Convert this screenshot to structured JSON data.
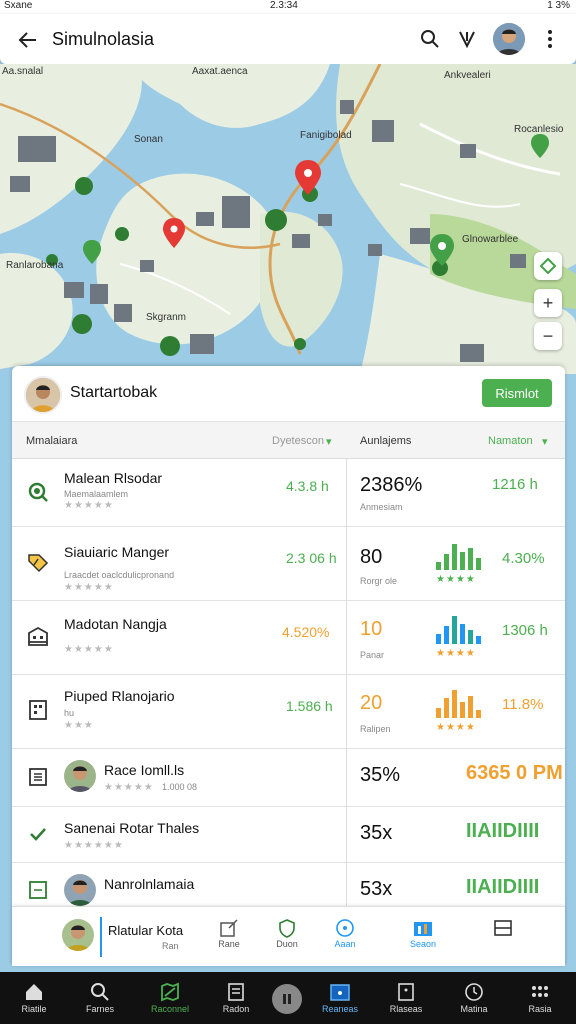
{
  "status_bar": {
    "left": "Sxane",
    "time": "2.3:34",
    "right": "1 3%"
  },
  "app_bar": {
    "title": "Simulnolasia"
  },
  "map": {
    "labels": [
      "Aa.snalal",
      "Aaxat.aenca",
      "Ankvealeri",
      "Sonan",
      "Fanigibolad",
      "Rocanlesio",
      "Ranlarobana",
      "Skgranm",
      "Glnowarblee"
    ]
  },
  "panel": {
    "title": "Startartobak",
    "action_button": "Rismlot",
    "columns": {
      "c1": "Mmalaiara",
      "c2": "Dyetescon",
      "c3": "Aunlajems",
      "c4": "Namaton"
    },
    "rows": [
      {
        "name": "Malean Rlsodar",
        "sub": "Maemalaamlem",
        "pct": "4.3.8 h",
        "big": "2386%",
        "big_sub": "Anmesiam",
        "right": "1216 h",
        "pct_color": "#4caf50",
        "right_color": "#4caf50",
        "icon": "search-icon"
      },
      {
        "name": "Siauiaric Manger",
        "sub": "Lraacdet oaclcdulicpronand",
        "pct": "2.3 06 h",
        "big": "80",
        "big_sub": "Rorgr ole",
        "right": "4.30%",
        "pct_color": "#4caf50",
        "right_color": "#4caf50",
        "icon": "tag-icon",
        "bars": "green"
      },
      {
        "name": "Madotan Nangja",
        "sub": "",
        "pct": "4.520%",
        "big": "10",
        "big_sub": "Panar",
        "right": "1306 h",
        "pct_color": "#f0a030",
        "right_color": "#4caf50",
        "icon": "building-icon",
        "bars": "blue"
      },
      {
        "name": "Piuped Rlanojario",
        "sub": "hu",
        "pct": "1.586 h",
        "big": "20",
        "big_sub": "Ralipen",
        "right": "11.8%",
        "pct_color": "#4caf50",
        "right_color": "#f0a030",
        "icon": "grid-icon",
        "bars": "orange"
      },
      {
        "name": "Race Iomll.ls",
        "sub": "1.000 08",
        "pct": "",
        "big": "35%",
        "big_sub": "",
        "right": "6365 0 PM",
        "right_color": "#f0a030",
        "icon": "list-icon",
        "avatar": true
      },
      {
        "name": "Sanenai Rotar Thales",
        "sub": "",
        "pct": "",
        "big": "35x",
        "big_sub": "",
        "right": "IIAIIDIIII",
        "right_color": "#4caf50",
        "icon": "check-icon"
      },
      {
        "name": "Nanrolnlamaia",
        "sub": "",
        "pct": "",
        "big": "53x",
        "big_sub": "",
        "right": "IIAIIDIIII",
        "right_color": "#4caf50",
        "icon": "list-icon",
        "avatar": true
      }
    ]
  },
  "tab_strip": {
    "profile_name": "Rlatular Kota",
    "profile_sub": "Ran",
    "tabs": [
      {
        "label": "Rane",
        "icon": "edit-icon"
      },
      {
        "label": "Duon",
        "icon": "shield-icon"
      },
      {
        "label": "Aaan",
        "icon": "target-icon"
      },
      {
        "label": "Seaon",
        "icon": "chart-icon"
      },
      {
        "label": "",
        "icon": "window-icon"
      }
    ]
  },
  "nav_bar": {
    "items": [
      {
        "label": "Riatile",
        "icon": "home-icon"
      },
      {
        "label": "Farnes",
        "icon": "search-icon"
      },
      {
        "label": "Raconnel",
        "icon": "map-icon"
      },
      {
        "label": "Radon",
        "icon": "doc-icon"
      },
      {
        "label": "",
        "icon": "center-icon"
      },
      {
        "label": "Reaneas",
        "icon": "calendar-icon"
      },
      {
        "label": "Rlaseas",
        "icon": "device-icon"
      },
      {
        "label": "Matina",
        "icon": "clock-icon"
      },
      {
        "label": "Rasia",
        "icon": "more-icon"
      }
    ]
  },
  "colors": {
    "accent": "#4caf50",
    "warn": "#f0a030",
    "blue": "#2196f3",
    "water": "#9ccbe6",
    "land": "#e8efe0"
  }
}
